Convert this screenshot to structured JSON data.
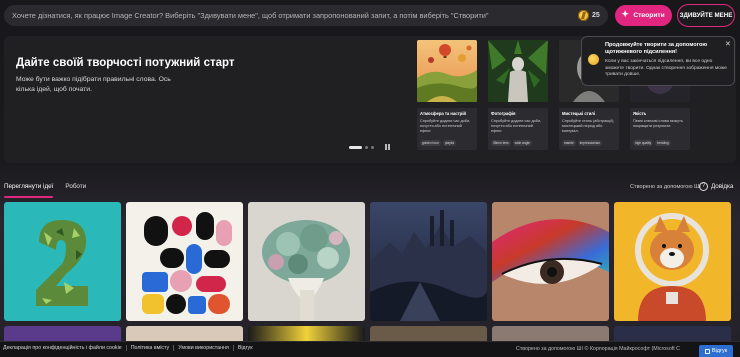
{
  "search": {
    "placeholder": "Хочете дізнатися, як працює Image Creator? Виберіть \"Здивувати мене\", щоб отримати запропонований запит, а потім виберіть \"Створити\"",
    "coins": "25"
  },
  "buttons": {
    "create": "Створити",
    "surprise": "ЗДИВУЙТЕ МЕНЕ"
  },
  "hero": {
    "title": "Дайте своїй творчості потужний старт",
    "subtitle": "Може бути важко підібрати правильні слова. Ось кілька ідей, щоб почати.",
    "cards": [
      {
        "title": "Атмосфера та настрій",
        "desc": "Спробуйте додати час доби, почуття або естетичний ефект.",
        "tags": [
          "golden hour",
          "playful"
        ]
      },
      {
        "title": "Фотографія",
        "desc": "Спробуйте додати час доби, почуття або естетичний ефект.",
        "tags": [
          "35mm lens",
          "wide angle"
        ]
      },
      {
        "title": "Мистецькі стилі",
        "desc": "Спробуйте стиль (абстракції), мистецький період або матеріал.",
        "tags": [
          "marble",
          "impressionism"
        ]
      },
      {
        "title": "Якість",
        "desc": "Певні ключові слова можуть покращити результат.",
        "tags": [
          "high quality",
          "trending"
        ]
      }
    ]
  },
  "tooltip": {
    "title": "Продовжуйте творити за допомогою щотижневого підсилення!",
    "text": "Коли у вас закінчаться підсилення, ви все одно зможете творити. Однак створення зображення може тривати довше."
  },
  "tabs": [
    {
      "label": "Переглянути ідеї",
      "active": true
    },
    {
      "label": "Роботи",
      "active": false
    }
  ],
  "ai_note": "Створено за допомогою ШІ",
  "help_label": "Довідка",
  "footer": {
    "links": [
      "Декларація про конфіденційність і файли cookie",
      "Політика вмісту",
      "Умови використання",
      "Відгук"
    ],
    "right": "Створено за допомогою ШІ  © Корпорація Майкрософт (Microsoft C",
    "feedback": "Відгук"
  },
  "colors": {
    "accent": "#e0267e",
    "background": "#141416",
    "panel": "#202023"
  }
}
